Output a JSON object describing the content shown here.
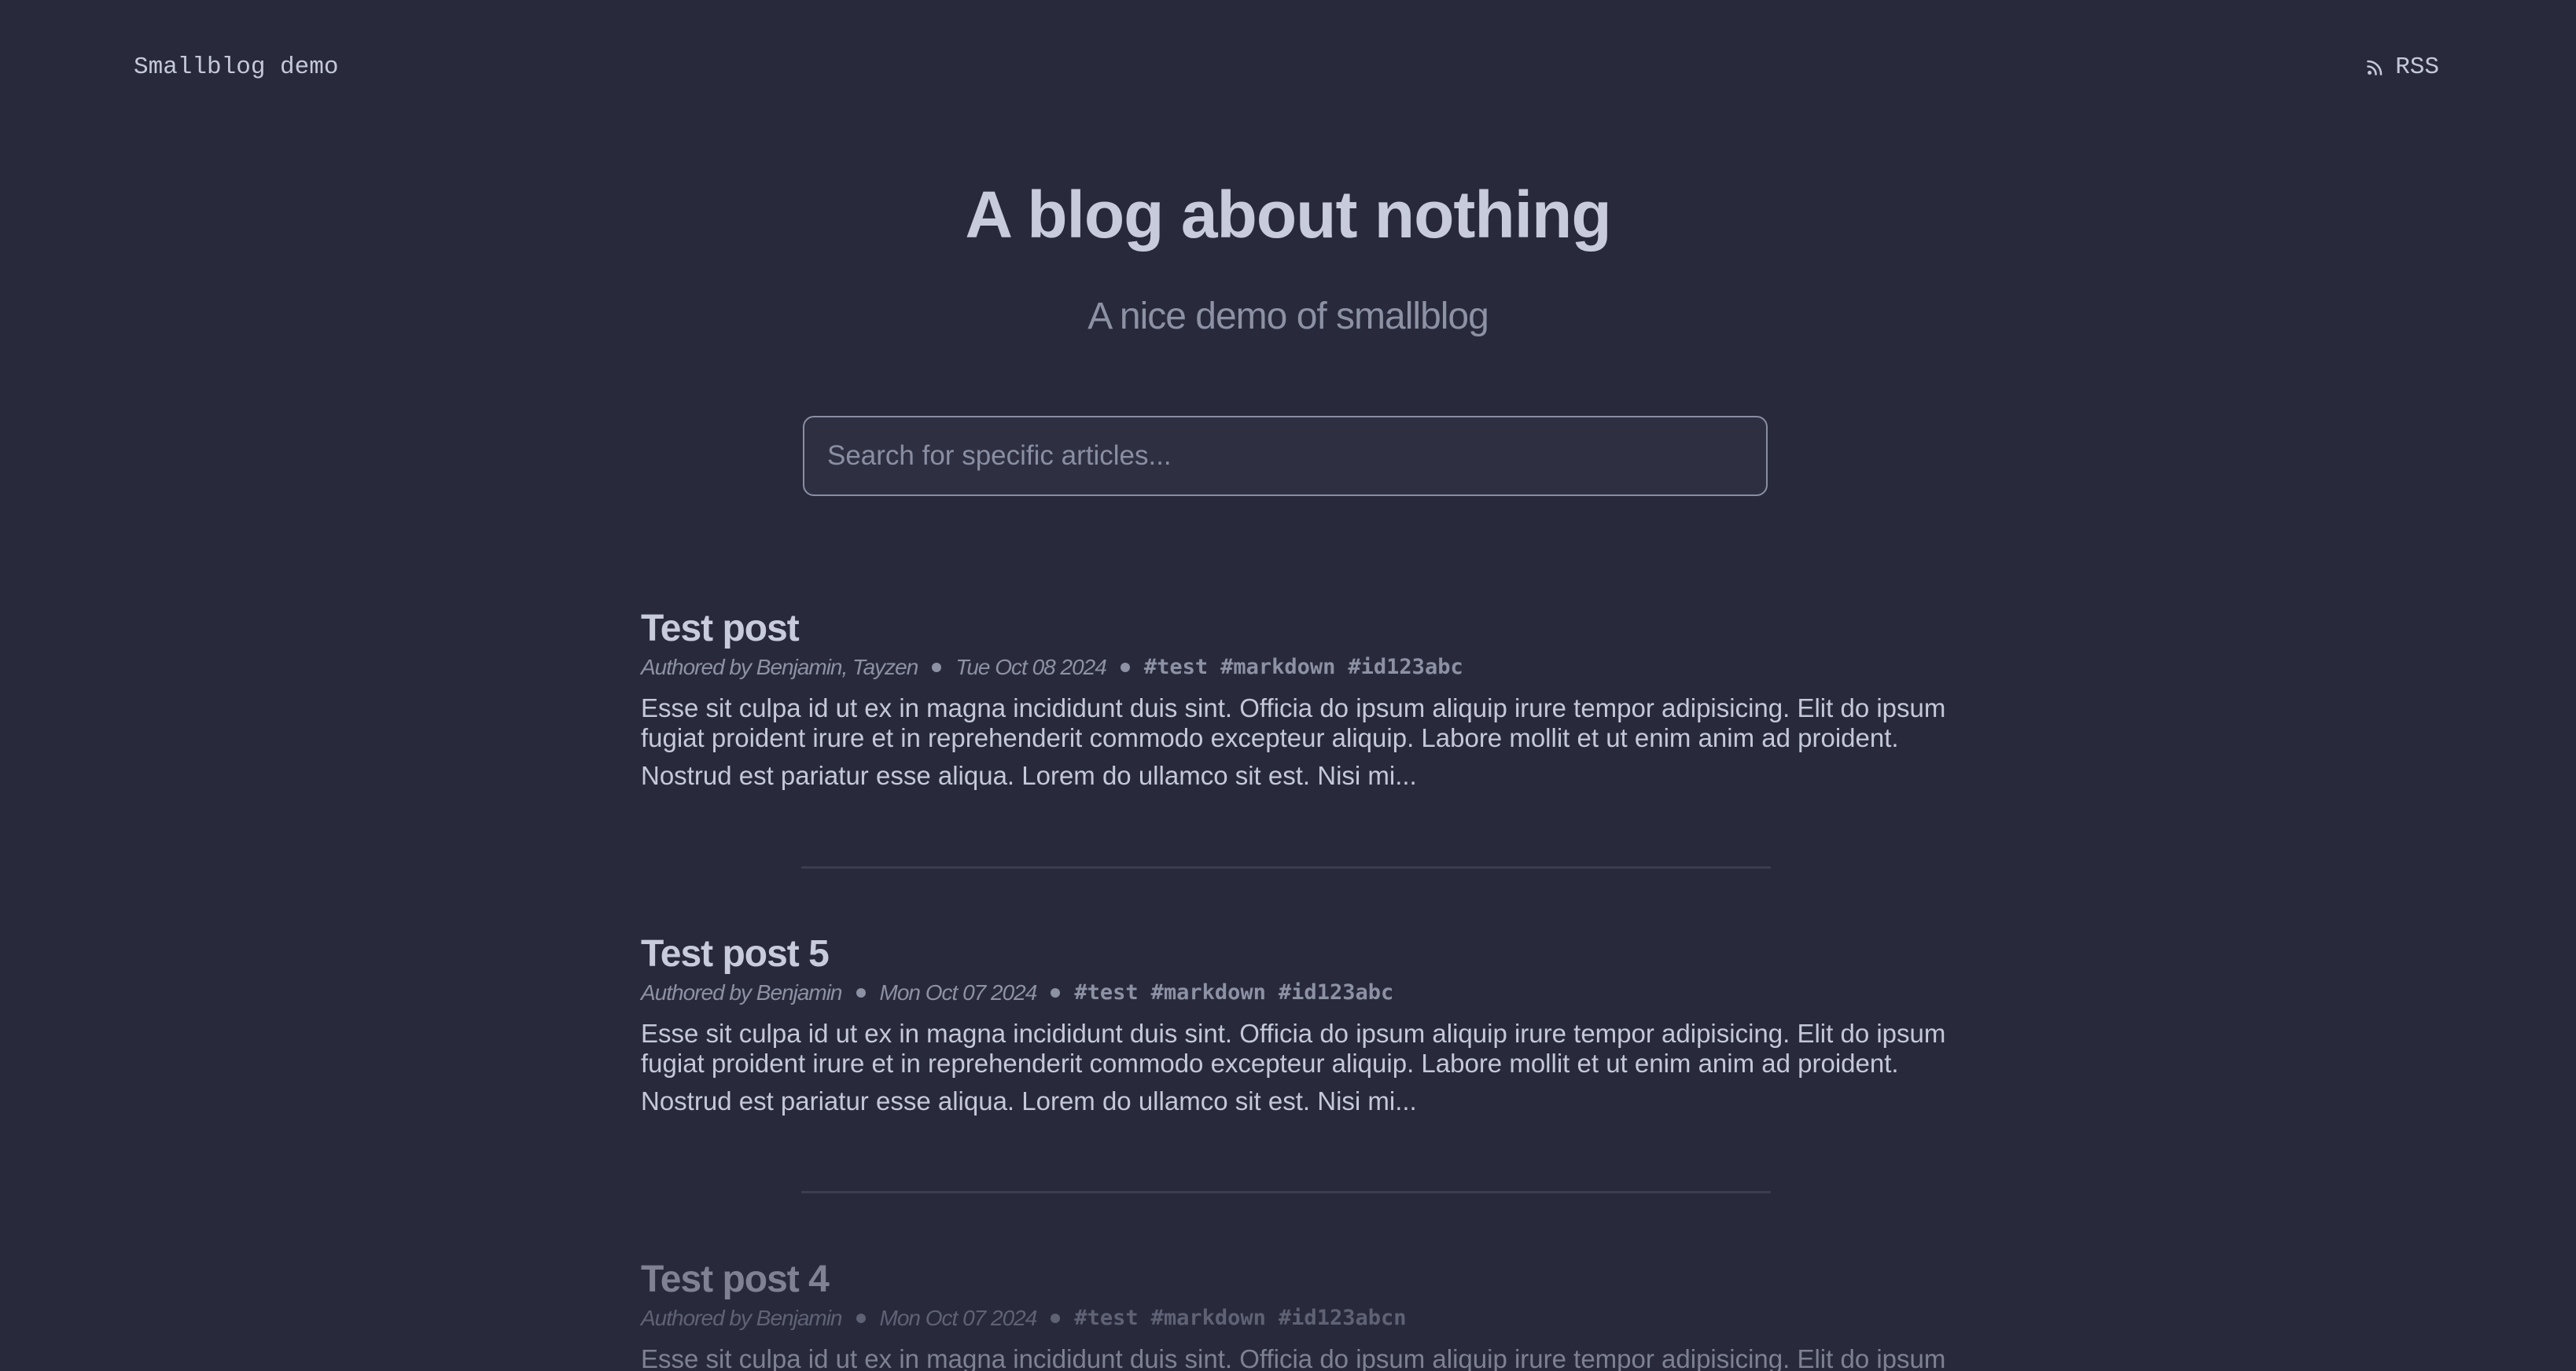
{
  "header": {
    "site_name": "Smallblog demo",
    "rss_label": "RSS",
    "rss_icon": "rss-icon"
  },
  "hero": {
    "title": "A blog about nothing",
    "subtitle": "A nice demo of smallblog"
  },
  "search": {
    "placeholder": "Search for specific articles...",
    "value": ""
  },
  "posts": [
    {
      "title": "Test post",
      "author": "Authored by Benjamin, Tayzen",
      "date": "Tue Oct 08 2024",
      "tags": [
        "#test",
        "#markdown",
        "#id123abc"
      ],
      "excerpt_line1": "Esse sit culpa id ut ex in magna incididunt duis sint. Officia do ipsum aliquip irure tempor adipisicing. Elit do ipsum fugiat proident irure et in reprehenderit commodo excepteur aliquip. Labore mollit et ut enim anim ad proident.",
      "excerpt_line2": "Nostrud est pariatur esse aliqua. Lorem do ullamco sit est. Nisi mi..."
    },
    {
      "title": "Test post 5",
      "author": "Authored by Benjamin",
      "date": "Mon Oct 07 2024",
      "tags": [
        "#test",
        "#markdown",
        "#id123abc"
      ],
      "excerpt_line1": "Esse sit culpa id ut ex in magna incididunt duis sint. Officia do ipsum aliquip irure tempor adipisicing. Elit do ipsum fugiat proident irure et in reprehenderit commodo excepteur aliquip. Labore mollit et ut enim anim ad proident.",
      "excerpt_line2": "Nostrud est pariatur esse aliqua. Lorem do ullamco sit est. Nisi mi..."
    },
    {
      "title": "Test post 4",
      "author": "Authored by Benjamin",
      "date": "Mon Oct 07 2024",
      "tags": [
        "#test",
        "#markdown",
        "#id123abcn"
      ],
      "excerpt_line1": "Esse sit culpa id ut ex in magna incididunt duis sint. Officia do ipsum aliquip irure tempor adipisicing. Elit do ipsum"
    }
  ]
}
